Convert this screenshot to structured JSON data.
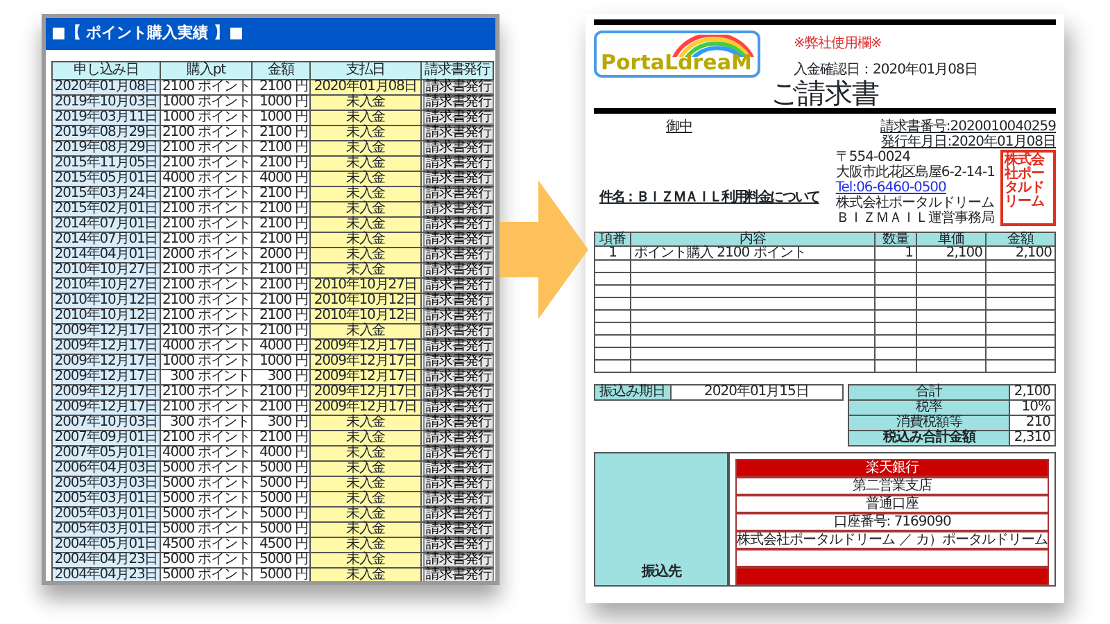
{
  "purchase_history": {
    "title": "■【 ポイント購入実績 】■",
    "columns": [
      "申し込み日",
      "購入pt",
      "金額",
      "支払日",
      "請求書発行"
    ],
    "rows": [
      {
        "date": "2020年01月08日",
        "points": "2100 ポイント",
        "amount": "2100 円",
        "payment": "2020年01月08日",
        "action": "請求書発行"
      },
      {
        "date": "2019年10月03日",
        "points": "1000 ポイント",
        "amount": "1000 円",
        "payment": "未入金",
        "action": "請求書発行"
      },
      {
        "date": "2019年03月11日",
        "points": "1000 ポイント",
        "amount": "1000 円",
        "payment": "未入金",
        "action": "請求書発行"
      },
      {
        "date": "2019年08月29日",
        "points": "2100 ポイント",
        "amount": "2100 円",
        "payment": "未入金",
        "action": "請求書発行"
      },
      {
        "date": "2019年08月29日",
        "points": "2100 ポイント",
        "amount": "2100 円",
        "payment": "未入金",
        "action": "請求書発行"
      },
      {
        "date": "2015年11月05日",
        "points": "2100 ポイント",
        "amount": "2100 円",
        "payment": "未入金",
        "action": "請求書発行"
      },
      {
        "date": "2015年05月01日",
        "points": "4000 ポイント",
        "amount": "4000 円",
        "payment": "未入金",
        "action": "請求書発行"
      },
      {
        "date": "2015年03月24日",
        "points": "2100 ポイント",
        "amount": "2100 円",
        "payment": "未入金",
        "action": "請求書発行"
      },
      {
        "date": "2015年02月01日",
        "points": "2100 ポイント",
        "amount": "2100 円",
        "payment": "未入金",
        "action": "請求書発行"
      },
      {
        "date": "2014年07月01日",
        "points": "2100 ポイント",
        "amount": "2100 円",
        "payment": "未入金",
        "action": "請求書発行"
      },
      {
        "date": "2014年07月01日",
        "points": "2100 ポイント",
        "amount": "2100 円",
        "payment": "未入金",
        "action": "請求書発行"
      },
      {
        "date": "2014年04月01日",
        "points": "2000 ポイント",
        "amount": "2000 円",
        "payment": "未入金",
        "action": "請求書発行"
      },
      {
        "date": "2010年10月27日",
        "points": "2100 ポイント",
        "amount": "2100 円",
        "payment": "未入金",
        "action": "請求書発行"
      },
      {
        "date": "2010年10月27日",
        "points": "2100 ポイント",
        "amount": "2100 円",
        "payment": "2010年10月27日",
        "action": "請求書発行"
      },
      {
        "date": "2010年10月12日",
        "points": "2100 ポイント",
        "amount": "2100 円",
        "payment": "2010年10月12日",
        "action": "請求書発行"
      },
      {
        "date": "2010年10月12日",
        "points": "2100 ポイント",
        "amount": "2100 円",
        "payment": "2010年10月12日",
        "action": "請求書発行"
      },
      {
        "date": "2009年12月17日",
        "points": "2100 ポイント",
        "amount": "2100 円",
        "payment": "未入金",
        "action": "請求書発行"
      },
      {
        "date": "2009年12月17日",
        "points": "4000 ポイント",
        "amount": "4000 円",
        "payment": "2009年12月17日",
        "action": "請求書発行"
      },
      {
        "date": "2009年12月17日",
        "points": "1000 ポイント",
        "amount": "1000 円",
        "payment": "2009年12月17日",
        "action": "請求書発行"
      },
      {
        "date": "2009年12月17日",
        "points": "300 ポイント",
        "amount": "300 円",
        "payment": "2009年12月17日",
        "action": "請求書発行"
      },
      {
        "date": "2009年12月17日",
        "points": "2100 ポイント",
        "amount": "2100 円",
        "payment": "2009年12月17日",
        "action": "請求書発行"
      },
      {
        "date": "2009年12月17日",
        "points": "2100 ポイント",
        "amount": "2100 円",
        "payment": "2009年12月17日",
        "action": "請求書発行"
      },
      {
        "date": "2007年10月03日",
        "points": "300 ポイント",
        "amount": "300 円",
        "payment": "未入金",
        "action": "請求書発行"
      },
      {
        "date": "2007年09月01日",
        "points": "2100 ポイント",
        "amount": "2100 円",
        "payment": "未入金",
        "action": "請求書発行"
      },
      {
        "date": "2007年05月01日",
        "points": "4000 ポイント",
        "amount": "4000 円",
        "payment": "未入金",
        "action": "請求書発行"
      },
      {
        "date": "2006年04月03日",
        "points": "5000 ポイント",
        "amount": "5000 円",
        "payment": "未入金",
        "action": "請求書発行"
      },
      {
        "date": "2005年03月03日",
        "points": "5000 ポイント",
        "amount": "5000 円",
        "payment": "未入金",
        "action": "請求書発行"
      },
      {
        "date": "2005年03月01日",
        "points": "5000 ポイント",
        "amount": "5000 円",
        "payment": "未入金",
        "action": "請求書発行"
      },
      {
        "date": "2005年03月01日",
        "points": "5000 ポイント",
        "amount": "5000 円",
        "payment": "未入金",
        "action": "請求書発行"
      },
      {
        "date": "2005年03月01日",
        "points": "5000 ポイント",
        "amount": "5000 円",
        "payment": "未入金",
        "action": "請求書発行"
      },
      {
        "date": "2004年05月01日",
        "points": "4500 ポイント",
        "amount": "4500 円",
        "payment": "未入金",
        "action": "請求書発行"
      },
      {
        "date": "2004年04月23日",
        "points": "5000 ポイント",
        "amount": "5000 円",
        "payment": "未入金",
        "action": "請求書発行"
      },
      {
        "date": "2004年04月23日",
        "points": "5000 ポイント",
        "amount": "5000 円",
        "payment": "未入金",
        "action": "請求書発行"
      }
    ]
  },
  "invoice": {
    "logo": "PortaLdreaM",
    "internal_note": "※弊社使用欄※",
    "payment_confirmed": "入金確認日：2020年01月08日",
    "title": "ご請求書",
    "addressee": "御中",
    "invoice_number": "請求書番号:2020010040259",
    "issue_date": "発行年月日:2020年01月08日",
    "sender": [
      "〒554-0024",
      "大阪市此花区島屋6-2-14-1",
      "Tel:06-6460-0500",
      "株式会社ポータルドリーム",
      "ＢＩＺＭＡＩＬ運営事務局"
    ],
    "stamp": "株式会社ポータルドリーム",
    "subject": "件名：ＢＩＺＭＡＩＬ利用料金について",
    "columns": [
      "項番",
      "内容",
      "数量",
      "単価",
      "金額"
    ],
    "items": [
      {
        "no": "1",
        "description": "ポイント購入 2100 ポイント",
        "quantity": "1",
        "unit_price": "2,100",
        "amount": "2,100"
      }
    ],
    "due_label": "振込み期日",
    "due_date": "2020年01月15日",
    "totals": [
      {
        "label": "合計",
        "value": "2,100"
      },
      {
        "label": "税率",
        "value": "10%"
      },
      {
        "label": "消費税額等",
        "value": "210"
      },
      {
        "label": "税込み合計金額",
        "value": "2,310"
      }
    ],
    "bank_label": "振込先",
    "bank": [
      "楽天銀行",
      "第二営業支店",
      "普通口座",
      "口座番号: 7169090",
      "株式会社ポータルドリーム ／ カ）ポータルドリーム"
    ]
  }
}
